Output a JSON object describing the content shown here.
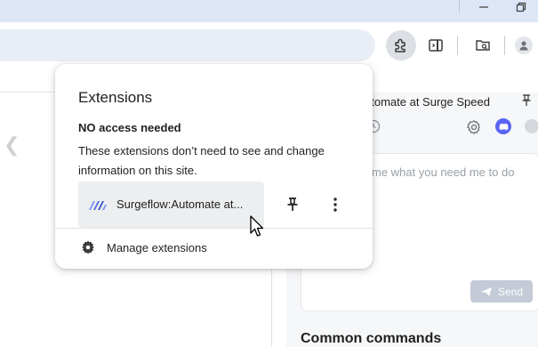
{
  "window": {
    "controls": {
      "minimize": "minimize-icon",
      "restore": "restore-icon"
    }
  },
  "toolbar": {
    "icons": [
      "extensions-icon",
      "side-panel-icon",
      "reading-list-icon",
      "profile-avatar"
    ]
  },
  "side_panel": {
    "title": "utomate at Surge Speed",
    "placeholder": "me what you need me to do",
    "send_label": "Send",
    "common_commands": "Common commands"
  },
  "popup": {
    "title": "Extensions",
    "section_heading": "NO access needed",
    "section_description": "These extensions don’t need to see and change information on this site.",
    "extensions": [
      {
        "name": "Surgeflow:Automate at...",
        "logo_color": "#4f6bdc"
      }
    ],
    "manage_label": "Manage extensions"
  },
  "colors": {
    "titlebar": "#dde6f7",
    "omnibox": "#e9eef6",
    "accent": "#4f6bdc",
    "discord": "#5865f2"
  }
}
